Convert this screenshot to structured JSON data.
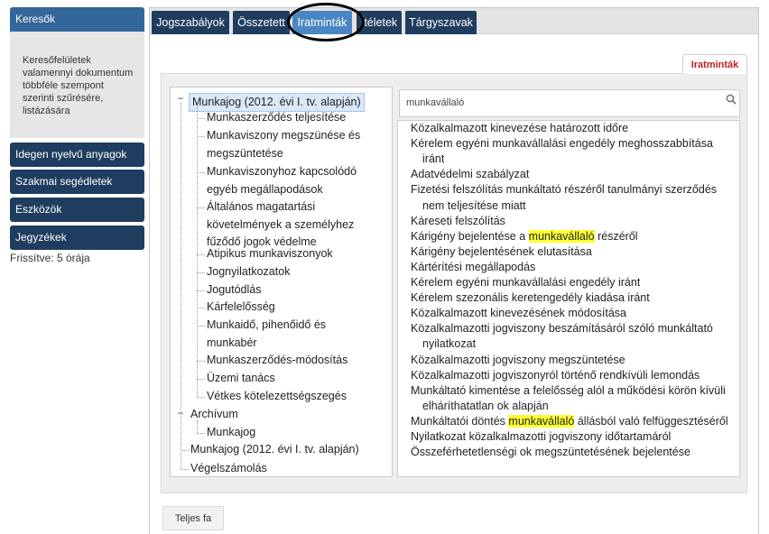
{
  "sidebar": {
    "search_title": "Keresők",
    "search_desc": [
      "Keresőfelületek",
      "valamennyi dokumentum",
      "többféle szempont",
      "szerinti szűrésére,",
      "listázására"
    ],
    "items": [
      "Idegen nyelvű anyagok",
      "Szakmai segédletek",
      "Eszközök",
      "Jegyzékek"
    ],
    "updated": "Frissítve: 5 órája"
  },
  "tabs": [
    "Jogszabályok",
    "Összetett",
    "Iratminták",
    "Ítéletek",
    "Tárgyszavak"
  ],
  "active_tab": "Iratminták",
  "panel_tab": "Iratminták",
  "tree": {
    "root_label": "Munkajog (2012. évi I. tv. alapján)",
    "root_children": [
      "Munkaszerződés teljesítése",
      [
        "Munkaviszony megszünése és",
        "megszüntetése"
      ],
      [
        "Munkaviszonyhoz kapcsolódó",
        "egyéb megállapodások"
      ],
      [
        "Általános magatartási",
        "követelmények a személyhez",
        "fűződő jogok védelme"
      ],
      "Atipikus munkaviszonyok",
      "Jognyilatkozatok",
      "Jogutódlás",
      "Kárfelelősség",
      [
        "Munkaidő, pihenőidő és",
        "munkabér"
      ],
      "Munkaszerződés-módosítás",
      "Üzemi tanács",
      "Vétkes kötelezettségszegés"
    ],
    "archive_label": "Archívum",
    "archive_children": [
      "Munkajog"
    ],
    "others": [
      "Munkajog (2012. évi I. tv. alapján)",
      "Végelszámolás"
    ]
  },
  "search": {
    "value": "munkavállaló"
  },
  "results": [
    [
      "Közalkalmazott kinevezése határozott időre"
    ],
    [
      "Kérelem egyéni munkavállalási engedély meghosszabbítása",
      "  iránt"
    ],
    [
      "Adatvédelmi szabályzat"
    ],
    [
      "Fizetési felszólítás munkáltató részéről tanulmányi szerződés",
      "  nem teljesítése miatt"
    ],
    [
      "Kárеseti felszólítás"
    ],
    [
      "Kárigény bejelentése a |munkavállaló| részéről"
    ],
    [
      "Kárigény bejelentésének elutasítása"
    ],
    [
      "Kártérítési megállapodás"
    ],
    [
      "Kérelem egyéni munkavállalási engedély iránt"
    ],
    [
      "Kérelem szezonális keretengedély kiadása iránt"
    ],
    [
      "Közalkalmazott kinevezésének módosítása"
    ],
    [
      "Közalkalmazotti jogviszony beszámításáról szóló munkáltató",
      "  nyilatkozat"
    ],
    [
      "Közalkalmazotti jogviszony megszüntetése"
    ],
    [
      "Közalkalmazotti jogviszonyról történő rendkívüli lemondás"
    ],
    [
      "Munkáltató kimentése a felelősség alól a működési körön kívüli",
      "  elháríthatatlan ok alapján"
    ],
    [
      "Munkáltatói döntés |munkavállaló| állásból való felfüggesztéséről"
    ],
    [
      "Nyilatkozat közalkalmazotti jogviszony időtartamáról"
    ],
    [
      "Összeférhetetlenségi ok megszüntetésének bejelentése"
    ]
  ],
  "full_tree_label": "Teljes fa"
}
